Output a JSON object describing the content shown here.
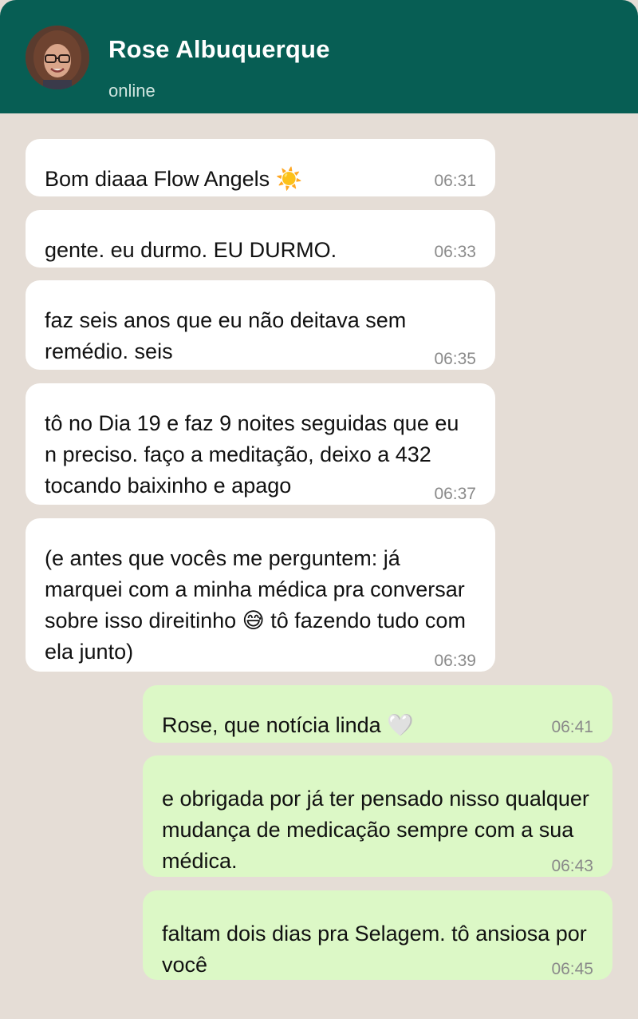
{
  "header": {
    "contact_name": "Rose Albuquerque",
    "status": "online"
  },
  "colors": {
    "header_bg": "#075e54",
    "chat_bg": "#e5ddd6",
    "incoming_bubble": "#ffffff",
    "outgoing_bubble": "#dcf8c6"
  },
  "messages": [
    {
      "direction": "incoming",
      "text": "Bom diaaa Flow Angels ☀️",
      "time": "06:31"
    },
    {
      "direction": "incoming",
      "text": "gente. eu durmo. EU DURMO.",
      "time": "06:33"
    },
    {
      "direction": "incoming",
      "text": "faz seis anos que eu não deitava sem remédio. seis",
      "time": "06:35"
    },
    {
      "direction": "incoming",
      "text": "tô no Dia 19 e faz 9 noites seguidas que eu n preciso. faço a meditação, deixo a 432 tocando baixinho e apago",
      "time": "06:37"
    },
    {
      "direction": "incoming",
      "text": "(e antes que vocês me perguntem: já marquei com a minha médica pra conversar sobre isso direitinho 😅 tô fazendo tudo com ela junto)",
      "time": "06:39"
    },
    {
      "direction": "outgoing",
      "text": "Rose, que notícia linda 🤍",
      "time": "06:41"
    },
    {
      "direction": "outgoing",
      "text": "e obrigada por já ter pensado nisso qualquer mudança de medicação sempre com a sua médica.",
      "time": "06:43"
    },
    {
      "direction": "outgoing",
      "text": "faltam dois dias pra Selagem. tô ansiosa por você",
      "time": "06:45"
    }
  ]
}
